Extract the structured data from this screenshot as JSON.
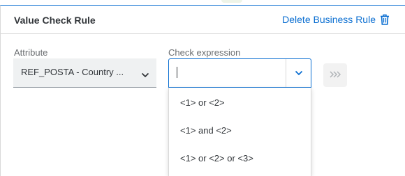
{
  "panel": {
    "title": "Value Check Rule",
    "delete_label": "Delete Business Rule"
  },
  "attribute": {
    "label": "Attribute",
    "value": "REF_POSTA - Country ...",
    "icon": "chevron-down-icon"
  },
  "check_expression": {
    "label": "Check expression",
    "value": "",
    "icon": "chevron-down-icon",
    "options": [
      "<1> or <2>",
      "<1> and <2>",
      "<1> or <2> or <3>"
    ]
  },
  "move_button": {
    "icon": "triple-chevron-right-icon"
  },
  "colors": {
    "accent": "#0a6ed1",
    "text": "#32363a",
    "label": "#6a6d70"
  }
}
